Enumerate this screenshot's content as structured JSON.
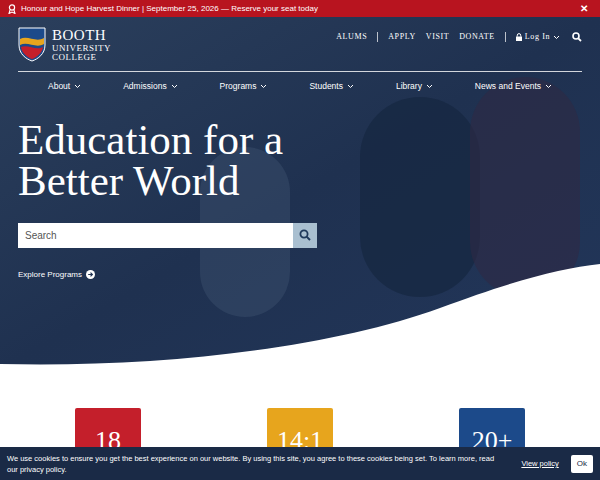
{
  "banner": {
    "text": "Honour and Hope Harvest Dinner | September 25, 2026 — Reserve your seat today",
    "close": "✕"
  },
  "logo": {
    "line1": "BOOTH",
    "line2": "UNIVERSITY",
    "line3": "COLLEGE"
  },
  "utility_links": [
    "ALUMS",
    "APPLY",
    "VISIT",
    "DONATE"
  ],
  "login": "Log In",
  "nav": [
    "About",
    "Admissions",
    "Programs",
    "Students",
    "Library",
    "News and Events"
  ],
  "hero": {
    "title_line1": "Education for a",
    "title_line2": "Better World"
  },
  "search": {
    "placeholder": "Search"
  },
  "explore": "Explore Programs",
  "stats": [
    {
      "value": "18",
      "color": "#c41f2b"
    },
    {
      "value": "14:1",
      "color": "#e7a51d"
    },
    {
      "value": "20+",
      "color": "#1c4a8a"
    }
  ],
  "cookie": {
    "text": "We use cookies to ensure you get the best experience on our website. By using this site, you agree to these cookies being set. To learn more, read our privacy policy.",
    "link": "View policy",
    "button": "Ok"
  }
}
